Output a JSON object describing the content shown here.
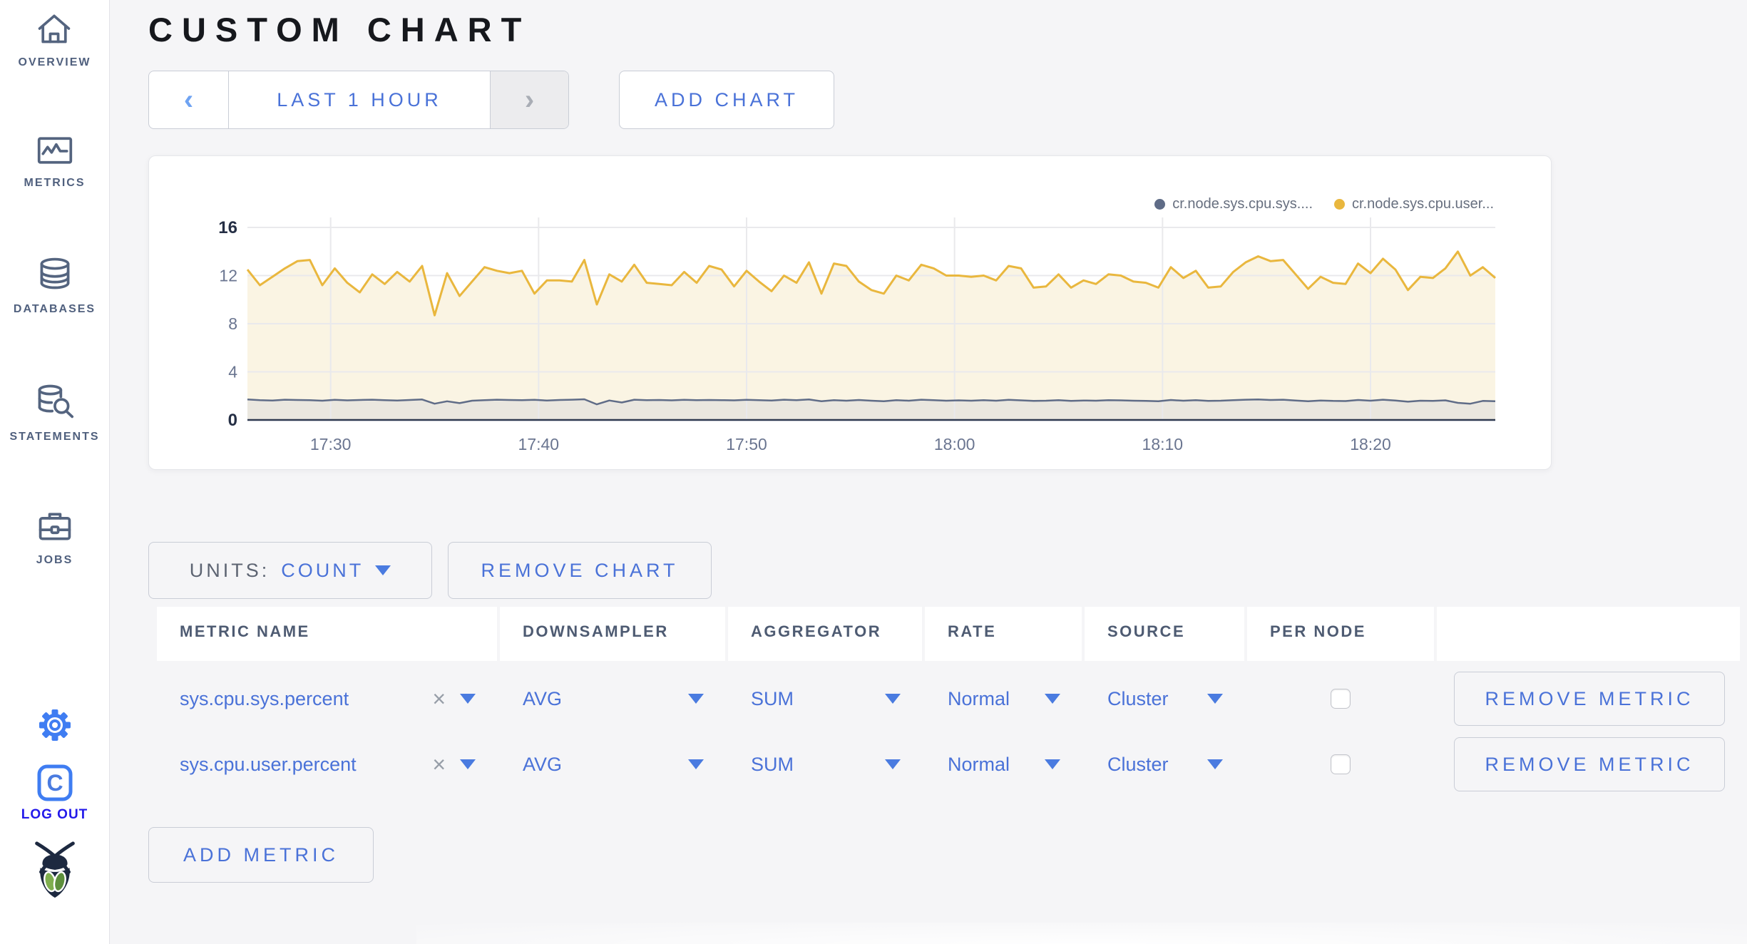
{
  "sidebar": {
    "items": [
      {
        "label": "OVERVIEW",
        "icon": "home-icon"
      },
      {
        "label": "METRICS",
        "icon": "metrics-icon"
      },
      {
        "label": "DATABASES",
        "icon": "databases-icon"
      },
      {
        "label": "STATEMENTS",
        "icon": "statements-icon"
      },
      {
        "label": "JOBS",
        "icon": "jobs-icon"
      }
    ],
    "logout_label": "LOG OUT"
  },
  "header": {
    "title": "CUSTOM CHART"
  },
  "toolbar": {
    "time_range_label": "LAST 1 HOUR",
    "prev_arrow": "‹",
    "next_arrow": "›",
    "add_chart_label": "ADD CHART"
  },
  "chart_controls": {
    "units_label": "UNITS:",
    "units_value": "COUNT",
    "remove_chart_label": "REMOVE CHART",
    "add_metric_label": "ADD METRIC"
  },
  "table": {
    "headers": [
      "METRIC NAME",
      "DOWNSAMPLER",
      "AGGREGATOR",
      "RATE",
      "SOURCE",
      "PER NODE",
      ""
    ],
    "rows": [
      {
        "metric_name": "sys.cpu.sys.percent",
        "clear": "×",
        "downsampler": "AVG",
        "aggregator": "SUM",
        "rate": "Normal",
        "source": "Cluster",
        "per_node": false,
        "remove_label": "REMOVE METRIC"
      },
      {
        "metric_name": "sys.cpu.user.percent",
        "clear": "×",
        "downsampler": "AVG",
        "aggregator": "SUM",
        "rate": "Normal",
        "source": "Cluster",
        "per_node": false,
        "remove_label": "REMOVE METRIC"
      }
    ]
  },
  "chart_data": {
    "type": "area",
    "title": "",
    "xlabel": "",
    "ylabel": "",
    "ylim": [
      0,
      16
    ],
    "y_ticks": [
      0,
      4,
      8,
      12,
      16
    ],
    "x_start": "17:26",
    "x_end": "18:26",
    "x_ticks": [
      "17:30",
      "17:40",
      "17:50",
      "18:00",
      "18:10",
      "18:20"
    ],
    "x_tick_offsets_min": [
      4,
      14,
      24,
      34,
      44,
      54
    ],
    "grid": true,
    "legend_position": "top-right",
    "series": [
      {
        "name": "cr.node.sys.cpu.sys....",
        "color": "#5f6c87",
        "fill": "#eae7df",
        "values": [
          1.7,
          1.65,
          1.62,
          1.68,
          1.66,
          1.64,
          1.6,
          1.67,
          1.63,
          1.66,
          1.68,
          1.65,
          1.62,
          1.66,
          1.7,
          1.35,
          1.55,
          1.4,
          1.6,
          1.65,
          1.68,
          1.66,
          1.64,
          1.67,
          1.62,
          1.66,
          1.68,
          1.72,
          1.3,
          1.62,
          1.45,
          1.68,
          1.65,
          1.66,
          1.63,
          1.67,
          1.64,
          1.66,
          1.65,
          1.63,
          1.67,
          1.65,
          1.62,
          1.68,
          1.64,
          1.7,
          1.56,
          1.65,
          1.6,
          1.66,
          1.6,
          1.56,
          1.65,
          1.6,
          1.68,
          1.64,
          1.6,
          1.63,
          1.6,
          1.65,
          1.6,
          1.67,
          1.63,
          1.58,
          1.6,
          1.64,
          1.58,
          1.62,
          1.6,
          1.65,
          1.63,
          1.6,
          1.58,
          1.56,
          1.66,
          1.6,
          1.64,
          1.58,
          1.6,
          1.64,
          1.68,
          1.7,
          1.66,
          1.68,
          1.62,
          1.55,
          1.62,
          1.58,
          1.57,
          1.66,
          1.6,
          1.68,
          1.62,
          1.52,
          1.6,
          1.58,
          1.63,
          1.42,
          1.35,
          1.58,
          1.55
        ]
      },
      {
        "name": "cr.node.sys.cpu.user...",
        "color": "#e9b73e",
        "fill": "#faf4e3",
        "values": [
          12.5,
          11.2,
          11.9,
          12.6,
          13.2,
          13.3,
          11.2,
          12.6,
          11.4,
          10.6,
          12.1,
          11.3,
          12.3,
          11.5,
          12.8,
          8.7,
          12.2,
          10.3,
          11.5,
          12.7,
          12.4,
          12.2,
          12.4,
          10.5,
          11.6,
          11.6,
          11.5,
          13.3,
          9.6,
          12.1,
          11.5,
          12.9,
          11.4,
          11.3,
          11.2,
          12.3,
          11.4,
          12.8,
          12.5,
          11.1,
          12.4,
          11.5,
          10.7,
          12.0,
          11.4,
          13.1,
          10.5,
          13.0,
          12.8,
          11.5,
          10.8,
          10.5,
          12.0,
          11.6,
          12.9,
          12.6,
          12.0,
          12.0,
          11.9,
          12.0,
          11.6,
          12.8,
          12.6,
          11.0,
          11.1,
          12.1,
          11.0,
          11.6,
          11.3,
          12.1,
          12.0,
          11.5,
          11.4,
          11.0,
          12.7,
          11.8,
          12.4,
          11.0,
          11.1,
          12.3,
          13.1,
          13.6,
          13.2,
          13.3,
          12.1,
          10.9,
          11.9,
          11.4,
          11.3,
          13.0,
          12.2,
          13.4,
          12.5,
          10.8,
          11.9,
          11.8,
          12.6,
          14.0,
          12.0,
          12.7,
          11.8
        ]
      }
    ]
  },
  "colors": {
    "accent_blue": "#4a72d8",
    "icon_blue": "#3f7df2",
    "logout_blue": "#2319ea",
    "sidebar_slate": "#50607e",
    "series_yellow": "#e9b73e",
    "series_gray": "#5f6c87",
    "fill_cream": "#faf4e3",
    "fill_beige": "#eae7df",
    "page_bg": "#f5f5f7",
    "baseline": "#2e3950"
  }
}
